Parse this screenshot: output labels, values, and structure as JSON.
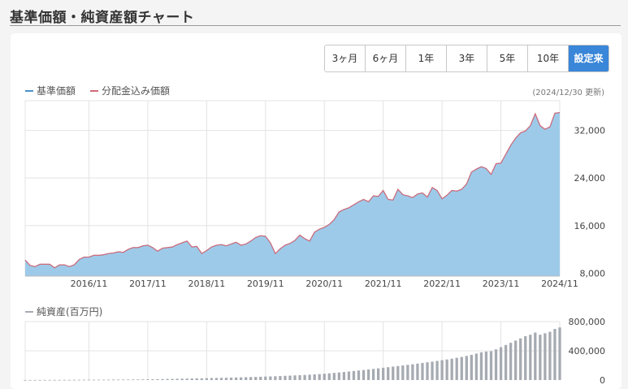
{
  "page": {
    "title": "基準価額・純資産額チャート"
  },
  "range_tabs": [
    {
      "label": "3ヶ月",
      "active": false
    },
    {
      "label": "6ヶ月",
      "active": false
    },
    {
      "label": "1年",
      "active": false
    },
    {
      "label": "3年",
      "active": false
    },
    {
      "label": "5年",
      "active": false
    },
    {
      "label": "10年",
      "active": false
    },
    {
      "label": "設定来",
      "active": true
    }
  ],
  "legend": {
    "nav_label": "基準価額",
    "dist_label": "分配金込み価額",
    "updated": "(2024/12/30 更新)",
    "assets_label": "純資産(百万円)"
  },
  "colors": {
    "nav_fill": "#9ecae9",
    "nav_line": "#4a90c8",
    "dist_line": "#d06a78",
    "bar": "#a6abb2",
    "active_tab": "#3a86d8"
  },
  "chart_data": [
    {
      "type": "area",
      "series": [
        {
          "name": "基準価額"
        },
        {
          "name": "分配金込み価額"
        }
      ],
      "x_start": "2015-10",
      "x_step": "1 month",
      "y": [
        10200,
        9300,
        9100,
        9500,
        9500,
        9500,
        8900,
        9400,
        9400,
        9100,
        9400,
        10300,
        10700,
        10700,
        11000,
        11000,
        11100,
        11300,
        11400,
        11600,
        11500,
        12000,
        12300,
        12300,
        12600,
        12700,
        12300,
        11700,
        12200,
        12300,
        12400,
        12800,
        13100,
        13400,
        12400,
        12500,
        11300,
        11800,
        12400,
        12700,
        12800,
        12600,
        12900,
        13200,
        12700,
        12900,
        13400,
        14000,
        14300,
        14200,
        13100,
        11300,
        12100,
        12700,
        13000,
        13500,
        14400,
        13800,
        13400,
        14900,
        15400,
        15700,
        16200,
        17000,
        18300,
        18700,
        19000,
        19500,
        20000,
        20400,
        20000,
        21000,
        20900,
        21900,
        20400,
        20300,
        22100,
        21200,
        21000,
        20700,
        21300,
        21500,
        20800,
        22400,
        21900,
        20500,
        21100,
        21900,
        21800,
        22100,
        23000,
        25000,
        25500,
        25900,
        25600,
        24600,
        26400,
        26500,
        28000,
        29500,
        30700,
        31600,
        31900,
        32800,
        34800,
        32800,
        32200,
        32600,
        34900,
        35000
      ],
      "x_ticks": [
        "2016/11",
        "2017/11",
        "2018/11",
        "2019/11",
        "2020/11",
        "2021/11",
        "2022/11",
        "2023/11",
        "2024/11"
      ],
      "y_ticks": [
        "32,000",
        "24,000",
        "16,000",
        "8,000"
      ],
      "ylim": [
        7500,
        37000
      ]
    },
    {
      "type": "bar",
      "series": [
        {
          "name": "純資産(百万円)"
        }
      ],
      "values": [
        1000,
        1200,
        1500,
        1700,
        2000,
        2200,
        2500,
        2800,
        3000,
        3300,
        3600,
        4000,
        4400,
        4700,
        5100,
        5400,
        5800,
        6100,
        6500,
        6900,
        7200,
        7600,
        8000,
        8500,
        9000,
        10000,
        11000,
        12000,
        13500,
        15000,
        16000,
        17500,
        19000,
        20000,
        21500,
        23000,
        24000,
        26000,
        27500,
        29000,
        30500,
        32000,
        33500,
        35000,
        37000,
        39000,
        41000,
        43000,
        45000,
        48000,
        50000,
        52000,
        55000,
        58000,
        61000,
        64000,
        67000,
        70000,
        74000,
        78000,
        82000,
        87000,
        92000,
        98000,
        104000,
        110000,
        117000,
        124000,
        131000,
        138000,
        145000,
        152000,
        160000,
        168000,
        176000,
        184000,
        192000,
        200000,
        208000,
        216000,
        225000,
        234000,
        243000,
        252000,
        262000,
        272000,
        282000,
        293000,
        304000,
        316000,
        330000,
        345000,
        362000,
        380000,
        390000,
        395000,
        420000,
        450000,
        480000,
        510000,
        540000,
        570000,
        600000,
        620000,
        650000,
        620000,
        640000,
        660000,
        700000,
        720000
      ],
      "y_ticks": [
        "800,000",
        "400,000",
        "0"
      ],
      "ylim": [
        0,
        800000
      ]
    }
  ]
}
